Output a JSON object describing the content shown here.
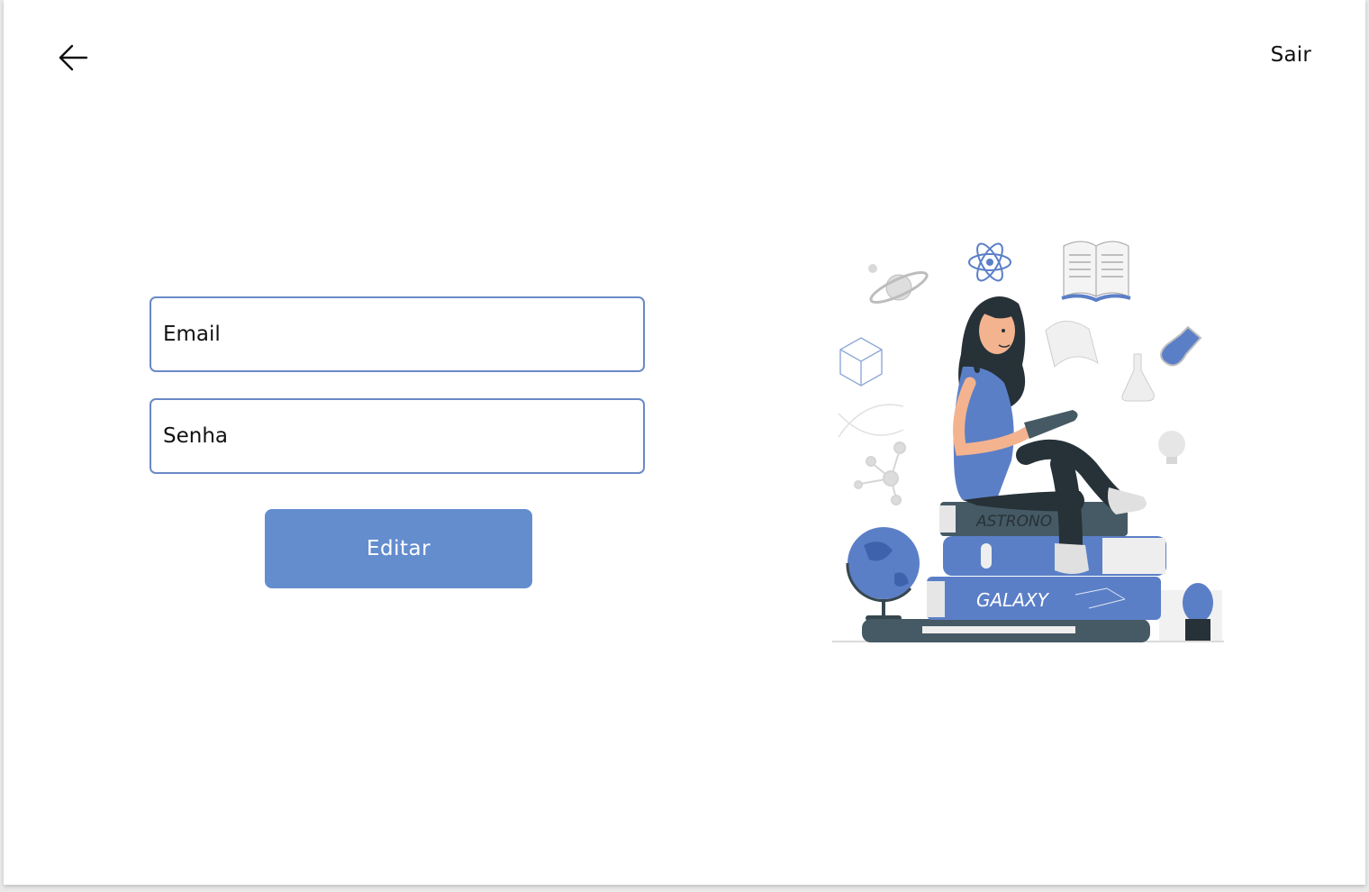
{
  "header": {
    "back_icon": "arrow-left-icon",
    "logout_label": "Sair"
  },
  "form": {
    "email_placeholder": "Email",
    "password_placeholder": "Senha",
    "submit_label": "Editar"
  },
  "illustration": {
    "book_top_label": "ASTRONO",
    "book_middle_label": "GALAXY"
  },
  "colors": {
    "accent": "#648dce",
    "field_border": "#6a89c6",
    "book_dark": "#455a64",
    "book_blue": "#5b7fc7"
  }
}
